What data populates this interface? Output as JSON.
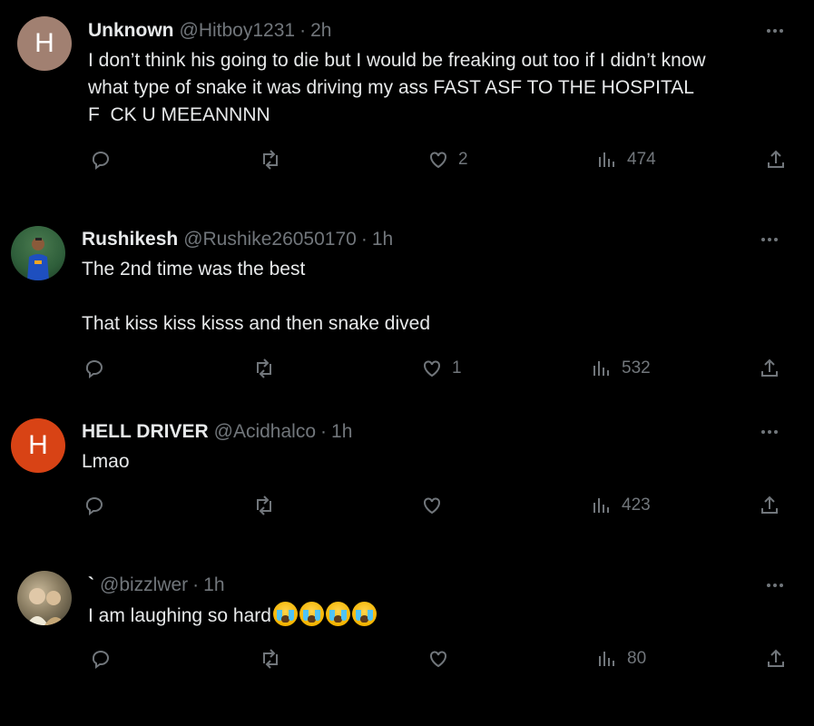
{
  "tweets": [
    {
      "avatar_letter": "H",
      "avatar_color": "#a18071",
      "name": "Unknown",
      "handle": "@Hitboy1231",
      "time": "2h",
      "text": "I don’t think his going to die but I would be freaking out too if I didn’t know\nwhat type of snake it was driving my ass FAST ASF TO THE HOSPITAL\nF  CK U MEEANNNN",
      "likes": "2",
      "views": "474"
    },
    {
      "avatar_letter": "",
      "avatar_color": "#2e5e3a",
      "name": "Rushikesh",
      "handle": "@Rushike26050170",
      "time": "1h",
      "text": "The 2nd time was the best\n\nThat kiss kiss kisss and then snake dived",
      "likes": "1",
      "views": "532"
    },
    {
      "avatar_letter": "H",
      "avatar_color": "#d84315",
      "name": "HELL DRIVER",
      "handle": "@Acidhalco",
      "time": "1h",
      "text": "Lmao",
      "likes": "",
      "views": "423"
    },
    {
      "avatar_letter": "",
      "avatar_color": "#6b6350",
      "name": "`",
      "handle": "@bizzlwer",
      "time": "1h",
      "text": "I am laughing so hard",
      "emoji": [
        "loudly-crying-face",
        "loudly-crying-face",
        "loudly-crying-face",
        "loudly-crying-face"
      ],
      "likes": "",
      "views": "80"
    }
  ],
  "separator": "·",
  "icons": {
    "reply": "reply-icon",
    "retweet": "retweet-icon",
    "like": "heart-icon",
    "views": "views-icon",
    "share": "share-icon",
    "more": "more-icon"
  },
  "colors": {
    "background": "#000000",
    "text": "#e7e9ea",
    "muted": "#71767b"
  }
}
